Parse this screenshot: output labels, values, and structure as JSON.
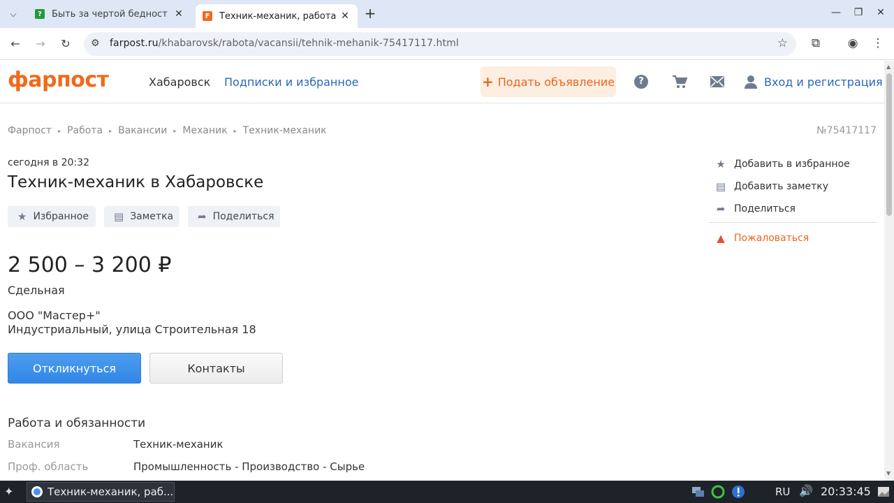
{
  "browser": {
    "tabs": [
      {
        "title": "Быть за чертой бедност",
        "favicon": "?",
        "favicon_color": "#1e9b3a",
        "active": false
      },
      {
        "title": "Техник-механик, работа",
        "favicon": "F",
        "favicon_color": "#f06a1d",
        "active": true
      }
    ],
    "url_host": "farpost.ru",
    "url_path": "/khabarovsk/rabota/vacansii/tehnik-mehanik-75417117.html"
  },
  "header": {
    "logo": "фарпост",
    "city": "Хабаровск",
    "subscriptions": "Подписки и избранное",
    "post_ad": "Подать объявление",
    "login": "Вход и регистрация"
  },
  "breadcrumbs": [
    "Фарпост",
    "Работа",
    "Вакансии",
    "Механик",
    "Техник-механик"
  ],
  "ad": {
    "number": "№75417117",
    "date": "сегодня в 20:32",
    "title": "Техник-механик в Хабаровске",
    "actions": {
      "favorite": "Избранное",
      "note": "Заметка",
      "share": "Поделиться"
    },
    "salary": "2 500 – 3 200 ₽",
    "pay_type": "Сдельная",
    "company": "ООО \"Мастер+\"",
    "address": "Индустриальный, улица Строительная 18",
    "respond": "Откликнуться",
    "contacts": "Контакты",
    "section_title": "Работа и обязанности",
    "properties": [
      {
        "label": "Вакансия",
        "value": "Техник-механик"
      },
      {
        "label": "Проф. область",
        "value": "Промышленность - Производство - Сырье"
      }
    ]
  },
  "sidebar": {
    "add_favorite": "Добавить в избранное",
    "add_note": "Добавить заметку",
    "share": "Поделиться",
    "complain": "Пожаловаться"
  },
  "taskbar": {
    "window_title": "Техник-механик, раб...",
    "lang": "RU",
    "clock": "20:33:45"
  },
  "colors": {
    "brand": "#f06a1d",
    "link": "#2a67b7",
    "primary_button": "#3187e6"
  }
}
